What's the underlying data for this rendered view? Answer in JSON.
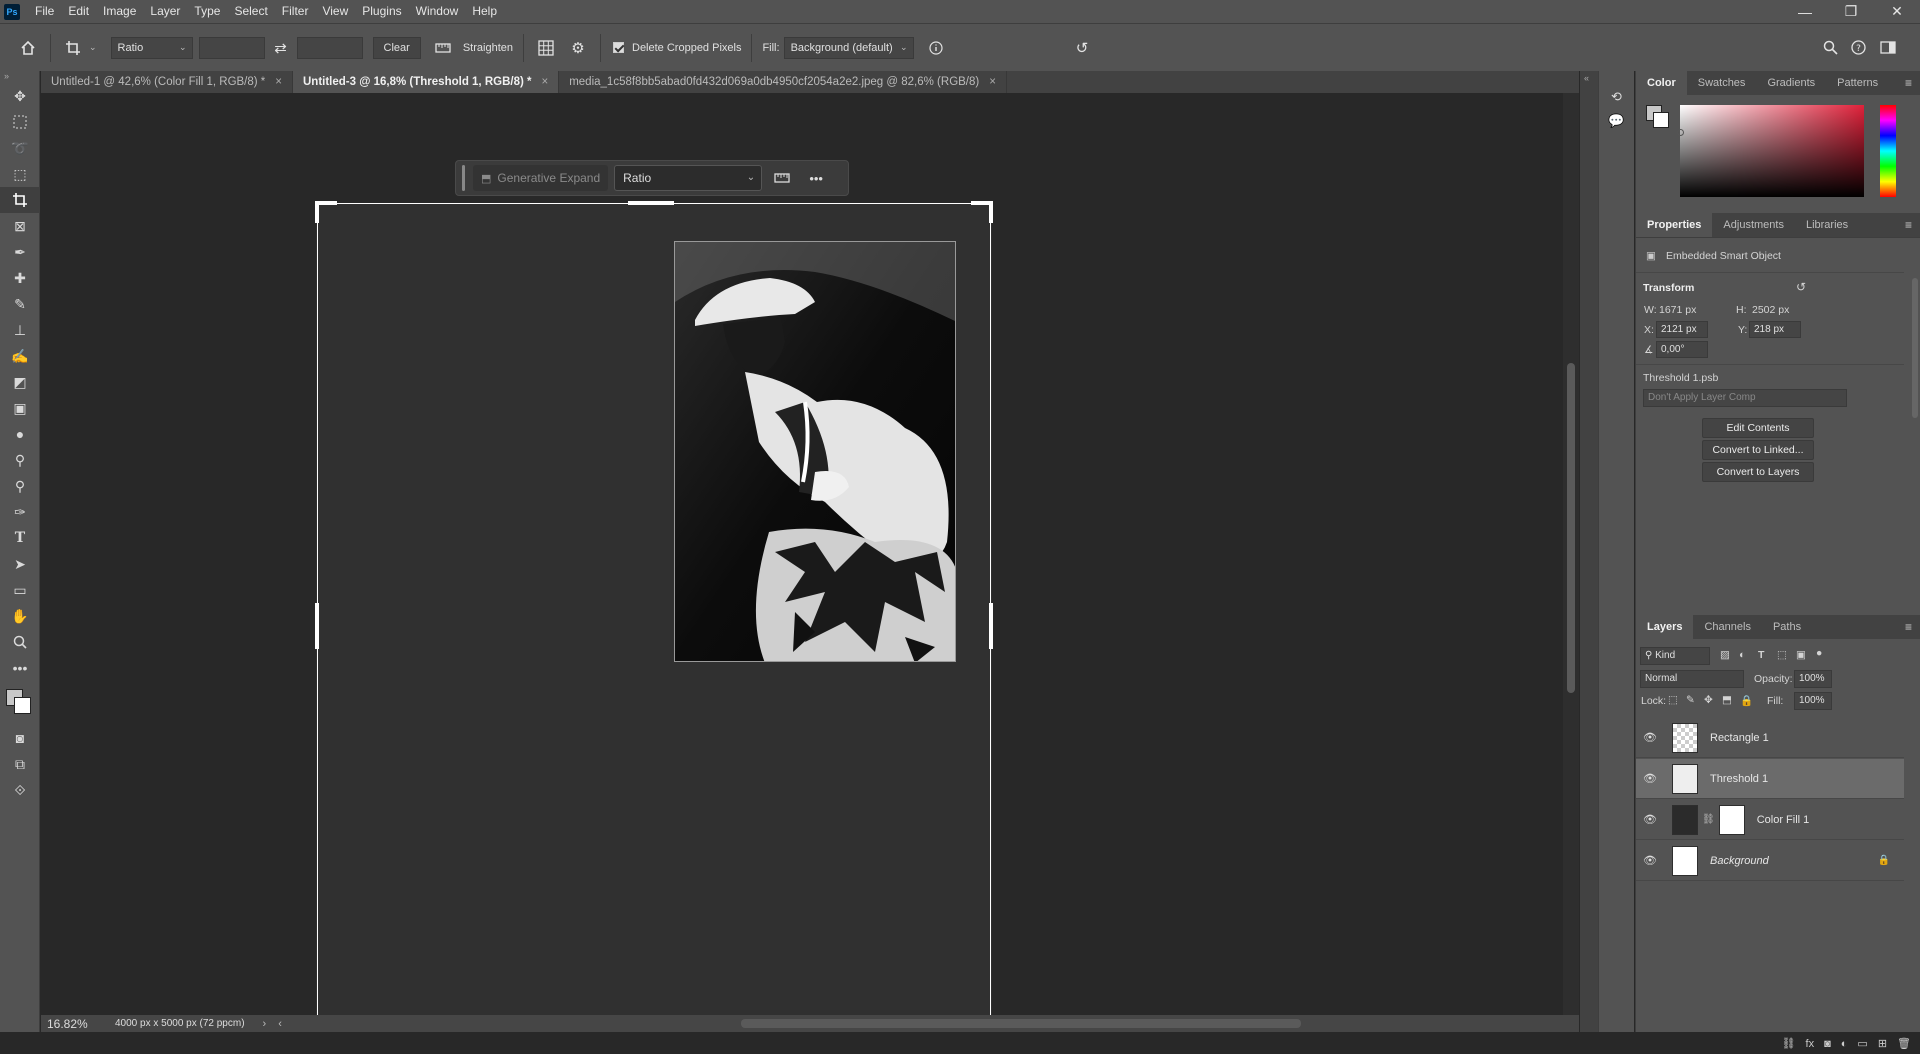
{
  "app": {
    "logo": "Ps"
  },
  "menu": [
    "File",
    "Edit",
    "Image",
    "Layer",
    "Type",
    "Select",
    "Filter",
    "View",
    "Plugins",
    "Window",
    "Help"
  ],
  "window_controls": {
    "minimize": "—",
    "restore": "❐",
    "close": "✕"
  },
  "options": {
    "ratio_select": "Ratio",
    "clear_label": "Clear",
    "straighten_label": "Straighten",
    "delete_cropped_label": "Delete Cropped Pixels",
    "fill_label": "Fill:",
    "fill_value": "Background (default)"
  },
  "tabs": [
    {
      "label": "Untitled-1 @ 42,6% (Color Fill 1, RGB/8) *",
      "close": "×"
    },
    {
      "label": "Untitled-3 @ 16,8% (Threshold 1, RGB/8) *",
      "close": "×"
    },
    {
      "label": "media_1c58f8bb5abad0fd432d069a0db4950cf2054a2e2.jpeg @ 82,6% (RGB/8)",
      "close": "×"
    }
  ],
  "context_bar": {
    "generative_expand": "Generative Expand",
    "ratio": "Ratio"
  },
  "status": {
    "zoom": "16.82%",
    "doc_info": "4000 px x 5000 px (72 ppcm)"
  },
  "color_panel": {
    "tabs": [
      "Color",
      "Swatches",
      "Gradients",
      "Patterns"
    ]
  },
  "properties_panel": {
    "tabs": [
      "Properties",
      "Adjustments",
      "Libraries"
    ],
    "object_type": "Embedded Smart Object",
    "transform_title": "Transform",
    "w_label": "W:",
    "w_value": "1671 px",
    "h_label": "H:",
    "h_value": "2502 px",
    "x_label": "X:",
    "x_value": "2121 px",
    "y_label": "Y:",
    "y_value": "218 px",
    "angle_value": "0,00°",
    "file_name": "Threshold 1.psb",
    "layer_comp": "Don't Apply Layer Comp",
    "buttons": [
      "Edit Contents",
      "Convert to Linked...",
      "Convert to Layers"
    ]
  },
  "layers_panel": {
    "tabs": [
      "Layers",
      "Channels",
      "Paths"
    ],
    "filter_kind": "Kind",
    "blend_mode": "Normal",
    "opacity_label": "Opacity:",
    "opacity_value": "100%",
    "lock_label": "Lock:",
    "fill_label": "Fill:",
    "fill_value": "100%",
    "layers": [
      {
        "name": "Rectangle 1"
      },
      {
        "name": "Threshold 1"
      },
      {
        "name": "Color Fill 1"
      },
      {
        "name": "Background"
      }
    ]
  }
}
